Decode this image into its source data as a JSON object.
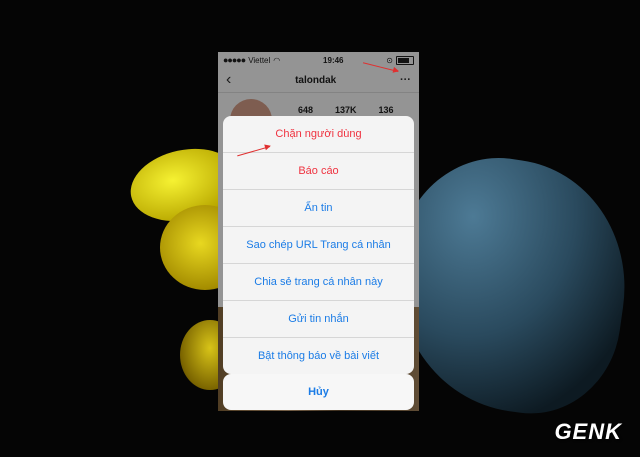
{
  "status_bar": {
    "carrier": "Viettel",
    "time": "19:46"
  },
  "nav": {
    "username": "talondak"
  },
  "stats": [
    "648",
    "137K",
    "136"
  ],
  "action_sheet": {
    "items": [
      {
        "label": "Chặn người dùng",
        "destructive": true
      },
      {
        "label": "Báo cáo",
        "destructive": true
      },
      {
        "label": "Ẩn tin",
        "destructive": false
      },
      {
        "label": "Sao chép URL Trang cá nhân",
        "destructive": false
      },
      {
        "label": "Chia sẻ trang cá nhân này",
        "destructive": false
      },
      {
        "label": "Gửi tin nhắn",
        "destructive": false
      },
      {
        "label": "Bật thông báo về bài viết",
        "destructive": false
      }
    ],
    "cancel_label": "Hủy"
  },
  "watermark": "GENK",
  "colors": {
    "destructive": "#ef3340",
    "action": "#1b7ce6",
    "annotation_arrow": "#e03030"
  }
}
